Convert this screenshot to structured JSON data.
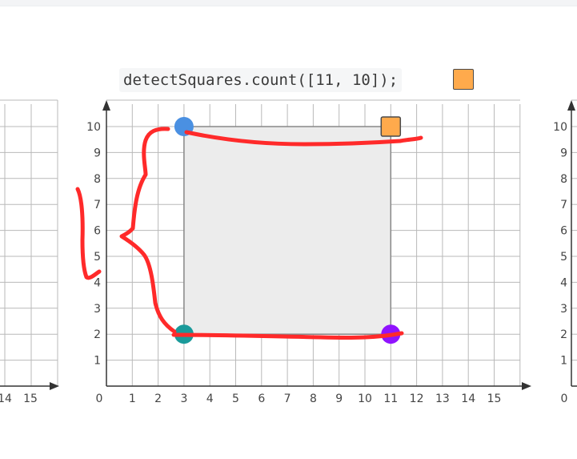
{
  "query": {
    "code": "detectSquares.count([11, 10]);",
    "swatch_color": "#FFAA4C"
  },
  "colors": {
    "grid": "#b9b9b9",
    "axis": "#333333",
    "square_fill": "#ececec",
    "square_stroke": "#888888",
    "annotation": "#ff2a2a"
  },
  "center_grid": {
    "origin_label": "0",
    "x_ticks": [
      "1",
      "2",
      "3",
      "4",
      "5",
      "6",
      "7",
      "8",
      "9",
      "10",
      "11",
      "12",
      "13",
      "14",
      "15"
    ],
    "y_ticks": [
      "1",
      "2",
      "3",
      "4",
      "5",
      "6",
      "7",
      "8",
      "9",
      "10"
    ],
    "square": {
      "x0": 3,
      "y0": 2,
      "x1": 11,
      "y1": 10
    },
    "points": [
      {
        "name": "point-3-10",
        "x": 3,
        "y": 10,
        "color": "#4A90E2"
      },
      {
        "name": "point-3-2",
        "x": 3,
        "y": 2,
        "color": "#1A9A9A"
      },
      {
        "name": "point-11-2",
        "x": 11,
        "y": 2,
        "color": "#9013FE"
      }
    ],
    "query_point": {
      "x": 11,
      "y": 10,
      "color": "#FFAA4C"
    }
  },
  "left_grid": {
    "x_ticks": [
      "14",
      "15"
    ]
  },
  "right_grid": {
    "origin_label": "0",
    "y_ticks": [
      "1",
      "2",
      "3",
      "4",
      "5",
      "6",
      "7",
      "8",
      "9",
      "10"
    ]
  }
}
